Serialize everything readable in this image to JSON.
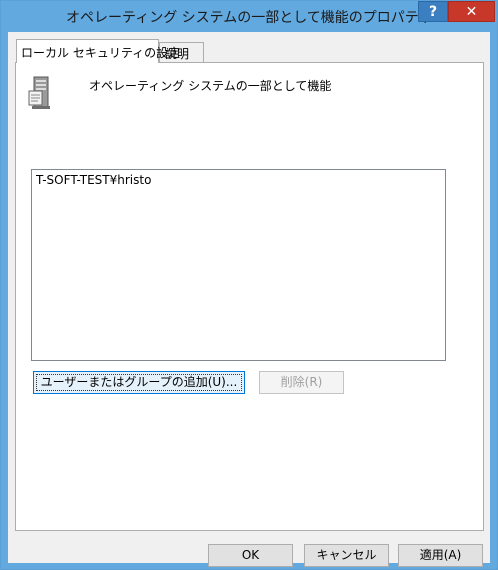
{
  "window": {
    "title": "オペレーティング システムの一部として機能のプロパティ",
    "help_label": "?",
    "close_label": "✕"
  },
  "tabs": [
    {
      "label": "ローカル セキュリティの設定",
      "selected": true
    },
    {
      "label": "説明",
      "selected": false
    }
  ],
  "policy": {
    "icon": "server-computer-icon",
    "name": "オペレーティング システムの一部として機能"
  },
  "accounts": [
    "T-SOFT-TEST¥hristo"
  ],
  "buttons": {
    "add_user_label": "ユーザーまたはグループの追加(U)...",
    "remove_label": "削除(R)",
    "ok_label": "OK",
    "cancel_label": "キャンセル",
    "apply_label": "適用(A)"
  },
  "colors": {
    "titlebar": "#62a9df",
    "close_button": "#c7382b",
    "help_button": "#3b7fc0",
    "focus_button": "#0078d7"
  }
}
